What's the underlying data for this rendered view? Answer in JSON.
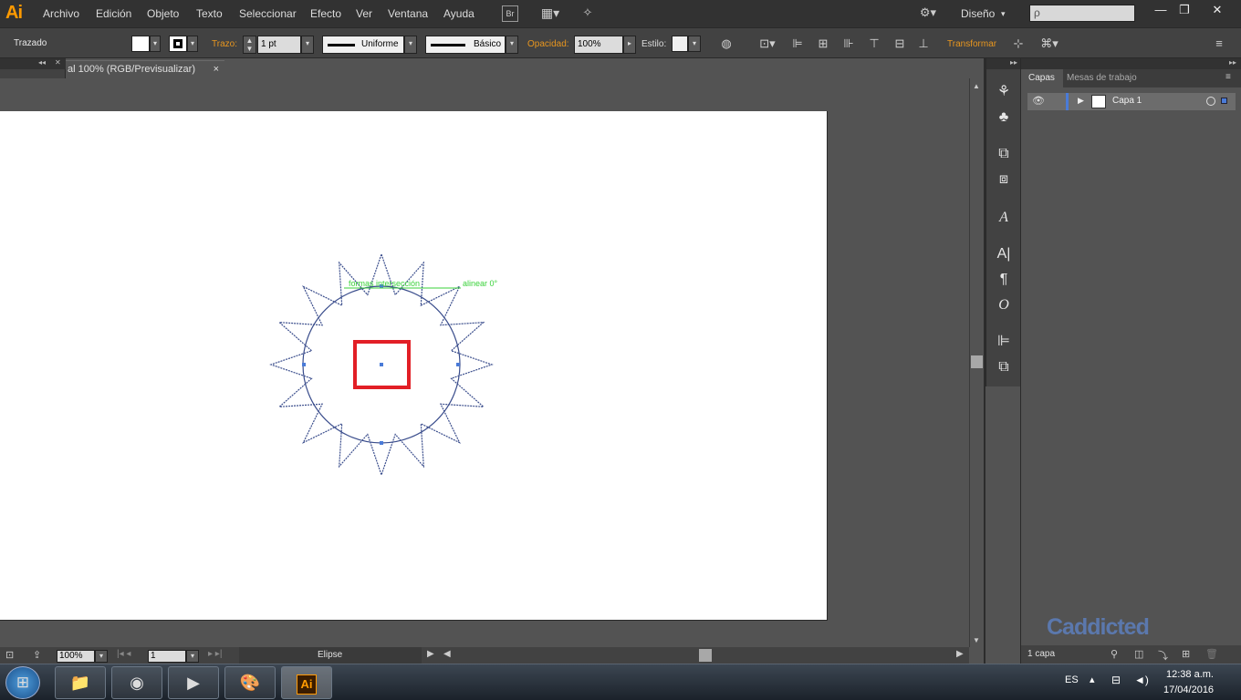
{
  "menubar": {
    "logo": "Ai",
    "items": [
      "Archivo",
      "Edición",
      "Objeto",
      "Texto",
      "Seleccionar",
      "Efecto",
      "Ver",
      "Ventana",
      "Ayuda"
    ],
    "bridge": "Br",
    "workspace": "Diseño",
    "search_placeholder": "ρ"
  },
  "controlbar": {
    "selection_label": "Trazado",
    "stroke_label": "Trazo:",
    "stroke_weight": "1 pt",
    "stroke_profile": "Uniforme",
    "brush_def": "Básico",
    "opacity_label": "Opacidad:",
    "opacity_value": "100%",
    "style_label": "Estilo:",
    "transform_label": "Transformar"
  },
  "document": {
    "tab_title": "al 100% (RGB/Previsualizar)",
    "close": "×"
  },
  "canvas": {
    "smart_guide_1": "formas intersección",
    "smart_guide_2": "alinear 0°",
    "guide_color": "#3ad23a",
    "path_color": "#3a4d8c",
    "rect_color": "#e21f26"
  },
  "statusbar": {
    "zoom": "100%",
    "artboard_num": "1",
    "current_tool": "Elipse"
  },
  "layers_panel": {
    "tab_layers": "Capas",
    "tab_artboards": "Mesas de trabajo",
    "layer_name": "Capa 1",
    "count_label": "1 capa",
    "watermark": "Caddicted"
  },
  "taskbar": {
    "language": "ES",
    "time": "12:38 a.m.",
    "date": "17/04/2016",
    "illustrator": "Ai"
  }
}
